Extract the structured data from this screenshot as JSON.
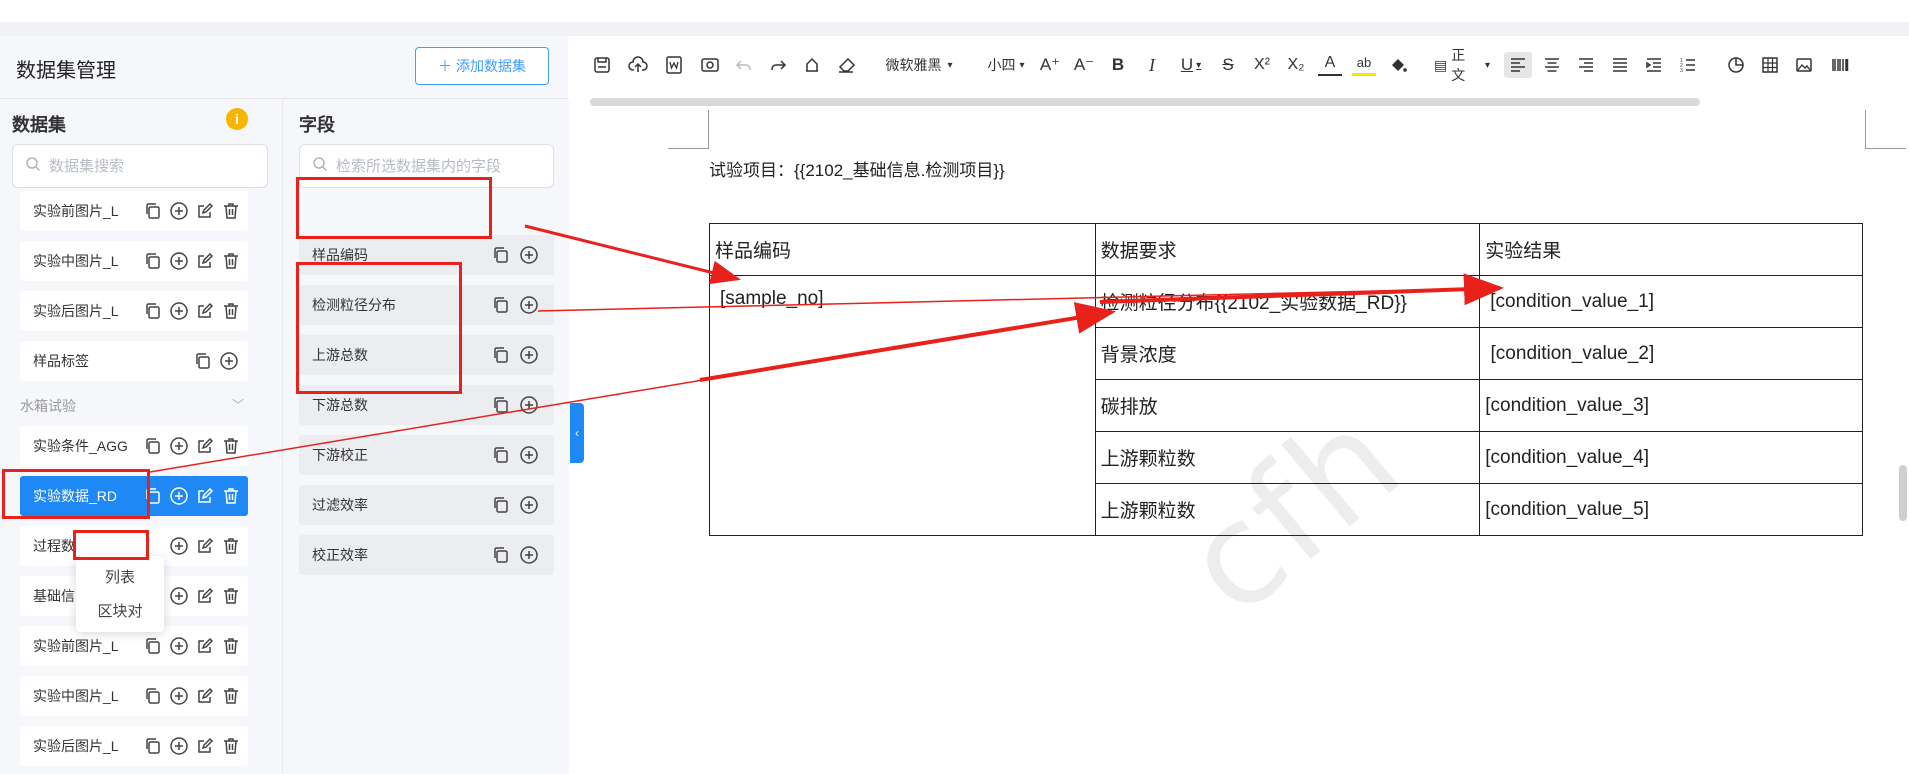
{
  "left_panel": {
    "title": "数据集管理",
    "add_button": "添加数据集",
    "dataset_section": {
      "title": "数据集",
      "search_placeholder": "数据集搜索",
      "items": [
        {
          "label": "实验前图片_L"
        },
        {
          "label": "实验中图片_L"
        },
        {
          "label": "实验后图片_L"
        },
        {
          "label": "样品标签"
        },
        {
          "label": "实验条件_AGG"
        },
        {
          "label": "实验数据_RD"
        },
        {
          "label": "过程数"
        },
        {
          "label": "基础信"
        },
        {
          "label": "实验前图片_L"
        },
        {
          "label": "实验中图片_L"
        },
        {
          "label": "实验后图片_L"
        }
      ],
      "group_label": "水箱试验",
      "popup_menu": [
        "列表",
        "区块对"
      ]
    },
    "field_section": {
      "title": "字段",
      "search_placeholder": "检索所选数据集内的字段",
      "items": [
        {
          "label": "样品编码"
        },
        {
          "label": "检测粒径分布"
        },
        {
          "label": "上游总数"
        },
        {
          "label": "下游总数"
        },
        {
          "label": "下游校正"
        },
        {
          "label": "过滤效率"
        },
        {
          "label": "校正效率"
        }
      ]
    }
  },
  "toolbar": {
    "font_family": "微软雅黑",
    "font_size": "小四",
    "paragraph_style": "正文"
  },
  "document": {
    "test_item_line": "试验项目：{{2102_基础信息.检测项目}}",
    "table": {
      "headers": [
        "样品编码",
        "数据要求",
        "实验结果"
      ],
      "sample_cell": "[sample_no]",
      "rows": [
        {
          "req": "检测粒径分布{{2102_实验数据_RD}}",
          "result": "[condition_value_1]"
        },
        {
          "req": "背景浓度",
          "result": " [condition_value_2]"
        },
        {
          "req": "碳排放",
          "result": "[condition_value_3]"
        },
        {
          "req": "上游颗粒数",
          "result": "[condition_value_4]"
        },
        {
          "req": "上游颗粒数",
          "result": "[condition_value_5]"
        }
      ]
    },
    "watermark": "cfh"
  },
  "colors": {
    "accent": "#1e88f5",
    "annotation": "#e8211b",
    "info": "#f7b500"
  }
}
